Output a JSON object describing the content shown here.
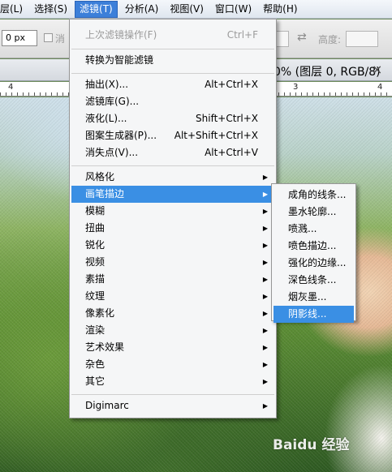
{
  "menubar": {
    "items": [
      {
        "label": "层(L)"
      },
      {
        "label": "选择(S)"
      },
      {
        "label": "滤镜(T)",
        "active": true
      },
      {
        "label": "分析(A)"
      },
      {
        "label": "视图(V)"
      },
      {
        "label": "窗口(W)"
      },
      {
        "label": "帮助(H)"
      }
    ]
  },
  "options": {
    "px_value": "0 px",
    "checkbox_label": "消",
    "height_label": "高度:",
    "swap_icon": "⇄"
  },
  "document": {
    "title": "0% (图层 0, RGB/8)",
    "close_icon": "×",
    "ruler_labels": [
      "4",
      "3",
      "4"
    ]
  },
  "filter_menu": {
    "last_filter": {
      "label": "上次滤镜操作(F)",
      "shortcut": "Ctrl+F"
    },
    "convert_smart": "转换为智能滤镜",
    "extract": {
      "label": "抽出(X)...",
      "shortcut": "Alt+Ctrl+X"
    },
    "gallery": {
      "label": "滤镜库(G)..."
    },
    "liquify": {
      "label": "液化(L)...",
      "shortcut": "Shift+Ctrl+X"
    },
    "pattern": {
      "label": "图案生成器(P)...",
      "shortcut": "Alt+Shift+Ctrl+X"
    },
    "vanishing": {
      "label": "消失点(V)...",
      "shortcut": "Alt+Ctrl+V"
    },
    "groups": [
      "风格化",
      "画笔描边",
      "模糊",
      "扭曲",
      "锐化",
      "视频",
      "素描",
      "纹理",
      "像素化",
      "渲染",
      "艺术效果",
      "杂色",
      "其它"
    ],
    "digimarc": "Digimarc"
  },
  "submenu": {
    "items": [
      "成角的线条...",
      "墨水轮廓...",
      "喷溅...",
      "喷色描边...",
      "强化的边缘...",
      "深色线条...",
      "烟灰墨...",
      "阴影线..."
    ]
  },
  "watermark": "Baidu 经验",
  "colors": {
    "menu_highlight": "#3a8fe4",
    "menu_bg": "#f5f6f7"
  }
}
